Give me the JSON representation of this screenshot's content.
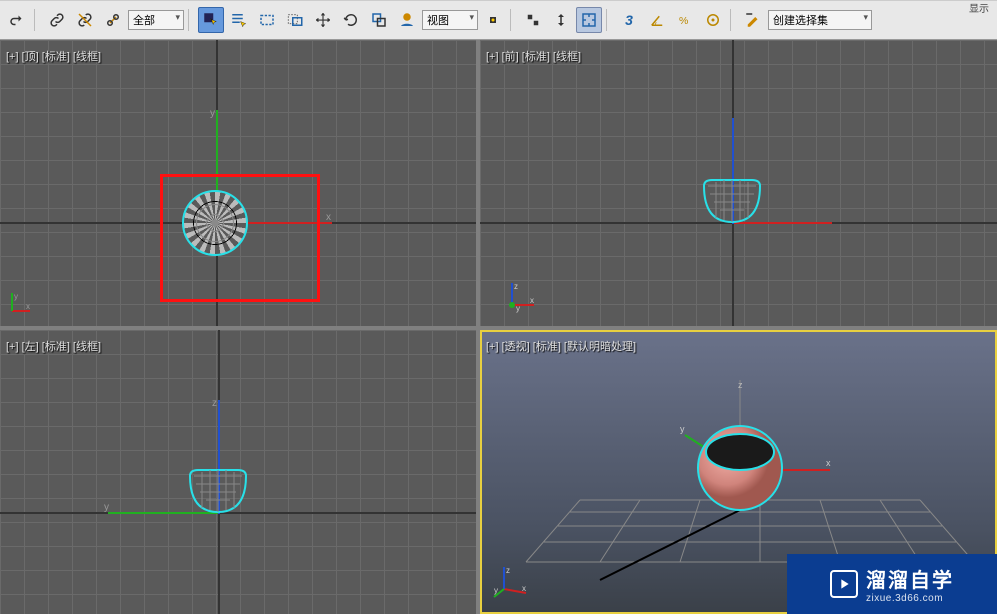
{
  "toolbar": {
    "redo": "↷",
    "dropdown_all": "全部",
    "dropdown_view": "视图",
    "dropdown_selset": "创建选择集",
    "three": "3"
  },
  "viewports": {
    "top": {
      "label": "[+] [顶] [标准] [线框]"
    },
    "front": {
      "label": "[+] [前] [标准] [线框]"
    },
    "left": {
      "label": "[+] [左] [标准] [线框]"
    },
    "persp": {
      "label": "[+] [透视] [标准] [默认明暗处理]"
    }
  },
  "axes": {
    "x": "x",
    "y": "y",
    "z": "z"
  },
  "watermark": {
    "main": "溜溜自学",
    "sub": "zixue.3d66.com"
  },
  "topright": "显示"
}
